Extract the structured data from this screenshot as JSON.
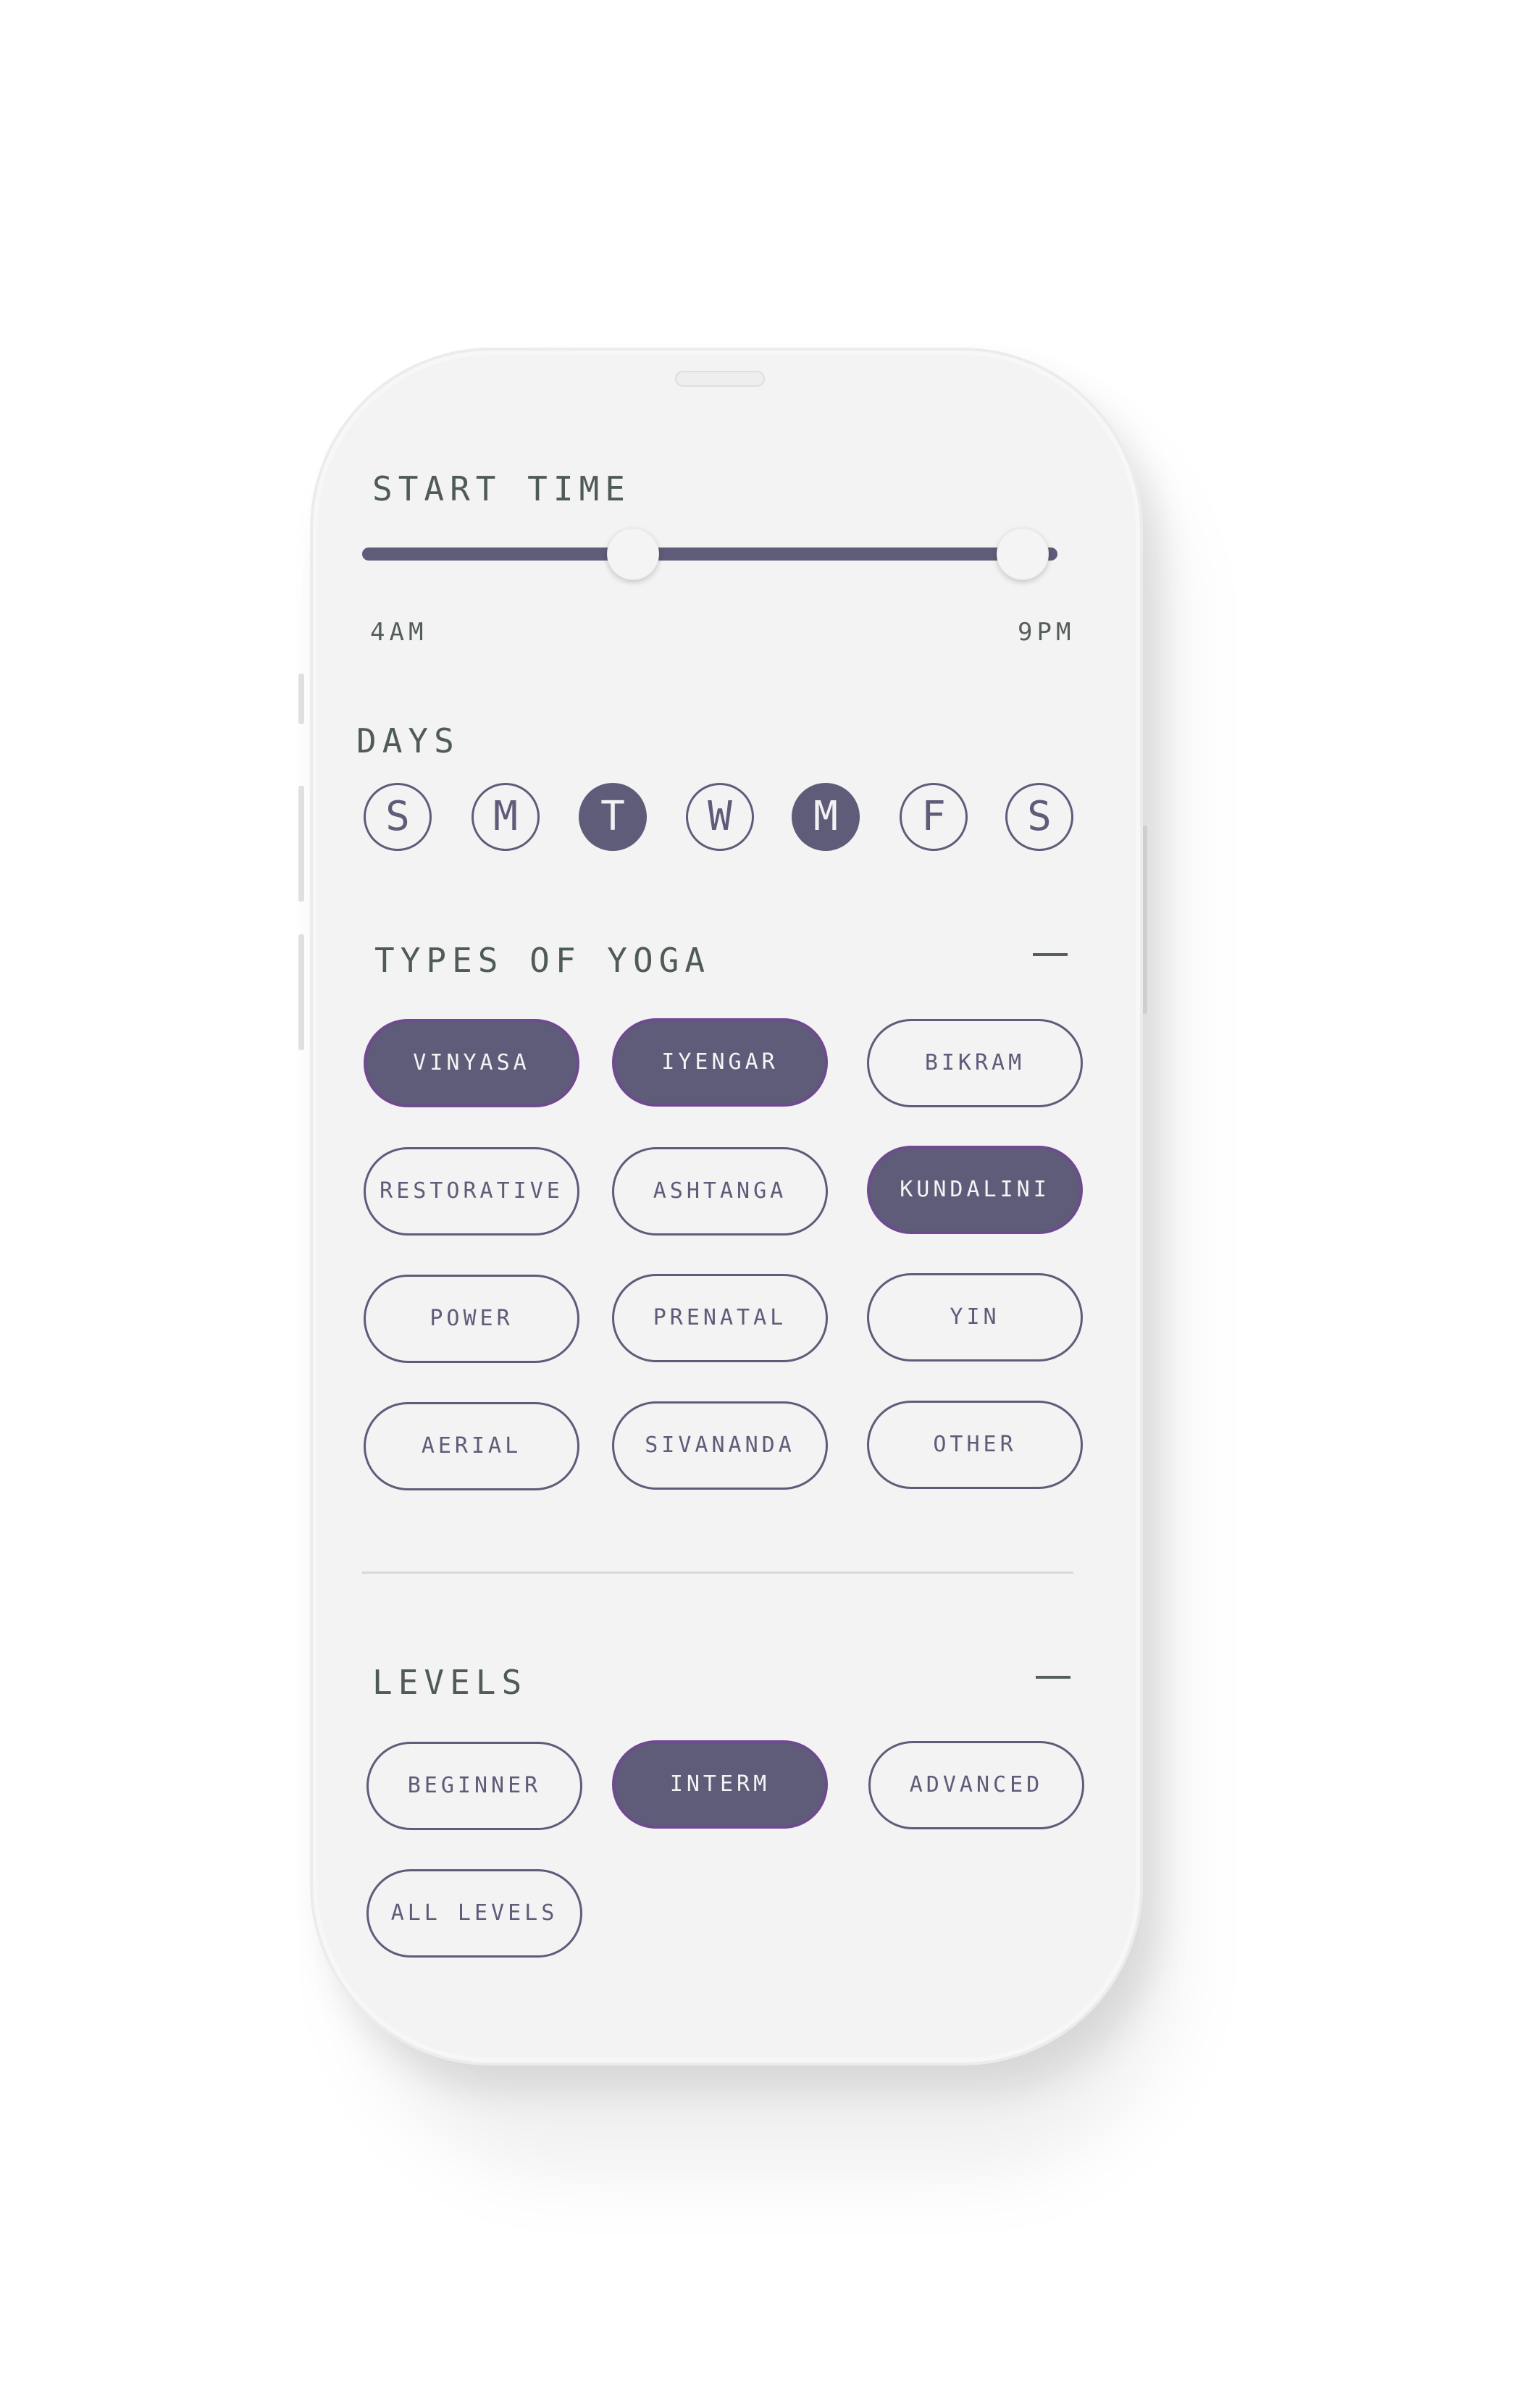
{
  "start_time": {
    "title": "START TIME",
    "min_label": "4AM",
    "max_label": "9PM",
    "range_fraction": [
      0.39,
      0.95
    ]
  },
  "days": {
    "title": "DAYS",
    "items": [
      {
        "label": "S",
        "selected": false
      },
      {
        "label": "M",
        "selected": false
      },
      {
        "label": "T",
        "selected": true
      },
      {
        "label": "W",
        "selected": false
      },
      {
        "label": "M",
        "selected": true
      },
      {
        "label": "F",
        "selected": false
      },
      {
        "label": "S",
        "selected": false
      }
    ]
  },
  "types": {
    "title": "TYPES OF YOGA",
    "collapse_icon": "minus-icon",
    "items": [
      {
        "label": "VINYASA",
        "selected": true
      },
      {
        "label": "IYENGAR",
        "selected": true
      },
      {
        "label": "BIKRAM",
        "selected": false
      },
      {
        "label": "RESTORATIVE",
        "selected": false
      },
      {
        "label": "ASHTANGA",
        "selected": false
      },
      {
        "label": "KUNDALINI",
        "selected": true
      },
      {
        "label": "POWER",
        "selected": false
      },
      {
        "label": "PRENATAL",
        "selected": false
      },
      {
        "label": "YIN",
        "selected": false
      },
      {
        "label": "AERIAL",
        "selected": false
      },
      {
        "label": "SIVANANDA",
        "selected": false
      },
      {
        "label": "OTHER",
        "selected": false
      }
    ]
  },
  "levels": {
    "title": "LEVELS",
    "collapse_icon": "minus-icon",
    "items": [
      {
        "label": "BEGINNER",
        "selected": false
      },
      {
        "label": "INTERM",
        "selected": true
      },
      {
        "label": "ADVANCED",
        "selected": false
      },
      {
        "label": "ALL LEVELS",
        "selected": false
      }
    ]
  },
  "colors": {
    "accent": "#5f5c79",
    "selected_border": "#6e4a8f",
    "title_text": "#4f5b55",
    "background": "#f3f3f3"
  }
}
